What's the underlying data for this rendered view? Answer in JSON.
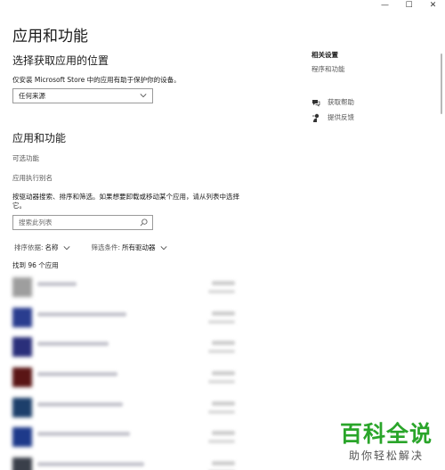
{
  "window": {
    "minimize_glyph": "—",
    "maximize_glyph": "☐",
    "close_glyph": "✕"
  },
  "page_title": "应用和功能",
  "location_section": {
    "title": "选择获取应用的位置",
    "description": "仅安装 Microsoft Store 中的应用有助于保护你的设备。",
    "dropdown_value": "任何来源"
  },
  "apps_section": {
    "title": "应用和功能",
    "optional_features_link": "可选功能",
    "app_execution_alias_link": "应用执行别名",
    "search_instructions": "按驱动器搜索、排序和筛选。如果想要卸载或移动某个应用，请从列表中选择它。",
    "search_placeholder": "搜索此列表",
    "sort_label": "排序依据:",
    "sort_value": "名称",
    "filter_label": "筛选条件:",
    "filter_value": "所有驱动器",
    "found_count": "找到 96 个应用"
  },
  "app_list": [
    {
      "icon_color": "#9e9e9e",
      "name_width_pct": 22
    },
    {
      "icon_color": "#2a3d8f",
      "name_width_pct": 50
    },
    {
      "icon_color": "#2a2f7a",
      "name_width_pct": 40
    },
    {
      "icon_color": "#5a1515",
      "name_width_pct": 45
    },
    {
      "icon_color": "#1d3f6b",
      "name_width_pct": 48
    },
    {
      "icon_color": "#1e3a8a",
      "name_width_pct": 52
    },
    {
      "icon_color": "#3a3f4a",
      "name_width_pct": 60
    }
  ],
  "related": {
    "title": "相关设置",
    "programs_link": "程序和功能",
    "help_label": "获取帮助",
    "feedback_label": "提供反馈"
  },
  "watermark": {
    "big": "百科全说",
    "small": "助你轻松解决"
  },
  "colors": {
    "watermark_green": "#2aa52a",
    "link_gray": "#555555"
  }
}
